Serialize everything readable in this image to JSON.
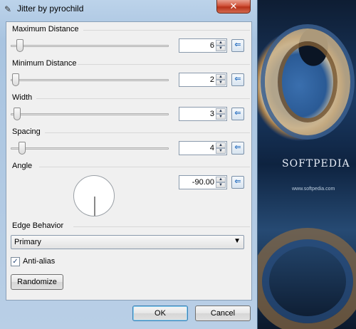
{
  "window": {
    "title": "Jitter by pyrochild",
    "close_label": "✕",
    "title_icon": "✎"
  },
  "colors": {
    "accent": "#3c7fb1",
    "reset_arrow": "#2a70c0"
  },
  "controls": {
    "max_distance": {
      "label": "Maximum Distance",
      "value": "6",
      "slider_fraction": 0.04
    },
    "min_distance": {
      "label": "Minimum Distance",
      "value": "2",
      "slider_fraction": 0.01
    },
    "width": {
      "label": "Width",
      "value": "3",
      "slider_fraction": 0.02
    },
    "spacing": {
      "label": "Spacing",
      "value": "4",
      "slider_fraction": 0.05
    },
    "angle": {
      "label": "Angle",
      "value": "-90.00"
    },
    "edge_behavior": {
      "label": "Edge Behavior",
      "selected": "Primary"
    },
    "anti_alias": {
      "label": "Anti-alias",
      "checked": true
    },
    "randomize_label": "Randomize"
  },
  "footer": {
    "ok_label": "OK",
    "cancel_label": "Cancel"
  },
  "icons": {
    "reset": "reset-arrow-icon",
    "spin_up": "spin-up-icon",
    "spin_down": "spin-down-icon"
  },
  "background": {
    "brand": "SOFTPEDIA",
    "url": "www.softpedia.com"
  }
}
